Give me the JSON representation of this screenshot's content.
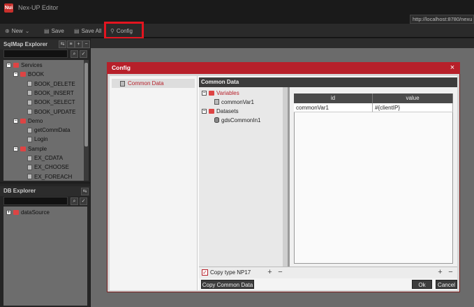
{
  "app": {
    "title": "Nex-UP Editor",
    "logo_text": "Nui",
    "url": "http://localhost:8780/nexu"
  },
  "toolbar": {
    "new_label": "New",
    "save_label": "Save",
    "save_all_label": "Save All",
    "config_label": "Config"
  },
  "sqlmap_explorer": {
    "title": "SqlMap Explorer",
    "tree": [
      {
        "label": "Services",
        "level": 0,
        "kind": "folder",
        "toggle": "−"
      },
      {
        "label": "BOOK",
        "level": 1,
        "kind": "folder",
        "toggle": "−"
      },
      {
        "label": "BOOK_DELETE",
        "level": 2,
        "kind": "file"
      },
      {
        "label": "BOOK_INSERT",
        "level": 2,
        "kind": "file"
      },
      {
        "label": "BOOK_SELECT",
        "level": 2,
        "kind": "file"
      },
      {
        "label": "BOOK_UPDATE",
        "level": 2,
        "kind": "file"
      },
      {
        "label": "Demo",
        "level": 1,
        "kind": "folder",
        "toggle": "−"
      },
      {
        "label": "getCommData",
        "level": 2,
        "kind": "file"
      },
      {
        "label": "Login",
        "level": 2,
        "kind": "file"
      },
      {
        "label": "Sample",
        "level": 1,
        "kind": "folder",
        "toggle": "−"
      },
      {
        "label": "EX_CDATA",
        "level": 2,
        "kind": "file"
      },
      {
        "label": "EX_CHOOSE",
        "level": 2,
        "kind": "file"
      },
      {
        "label": "EX_FOREACH",
        "level": 2,
        "kind": "file"
      }
    ]
  },
  "db_explorer": {
    "title": "DB Explorer",
    "tree": [
      {
        "label": "dataSource",
        "toggle": "+"
      }
    ]
  },
  "dialog": {
    "title": "Config",
    "close_glyph": "×",
    "nav": [
      {
        "label": "Common Data"
      }
    ],
    "panel_title": "Common Data",
    "tree": [
      {
        "label": "Variables",
        "level": 0,
        "toggle": "−",
        "selected": true
      },
      {
        "label": "commonVar1",
        "level": 1
      },
      {
        "label": "Datasets",
        "level": 0,
        "toggle": "−"
      },
      {
        "label": "gdsCommonIn1",
        "level": 1
      }
    ],
    "grid": {
      "columns": [
        "id",
        "value"
      ],
      "rows": [
        [
          "commonVar1",
          "#{clientIP}"
        ]
      ]
    },
    "copy_type_label": "Copy type NP17",
    "copy_type_checked": true,
    "copy_button_label": "Copy Common Data",
    "ok_label": "Ok",
    "cancel_label": "Cancel",
    "add_glyph": "+",
    "remove_glyph": "−"
  }
}
